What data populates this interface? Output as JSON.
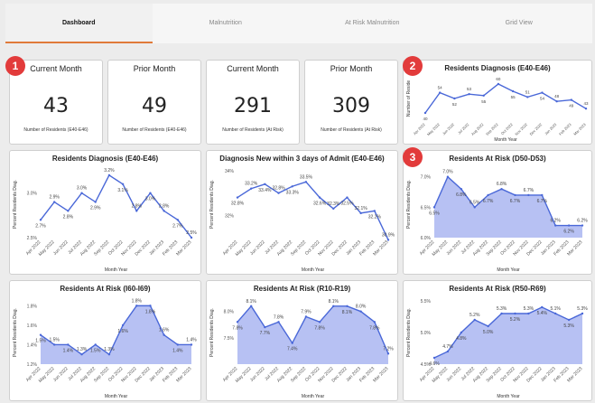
{
  "tabs": [
    {
      "label": "Dashboard",
      "active": true
    },
    {
      "label": "Malnutrition",
      "active": false
    },
    {
      "label": "At Risk Malnutrition",
      "active": false
    },
    {
      "label": "Grid View",
      "active": false
    }
  ],
  "badges": [
    "1",
    "2",
    "3"
  ],
  "kpis": [
    {
      "title": "Current Month",
      "value": "43",
      "sub": "Number of Residents (E40-E46)"
    },
    {
      "title": "Prior Month",
      "value": "49",
      "sub": "Number of Residents (E40-E46)"
    },
    {
      "title": "Current Month",
      "value": "291",
      "sub": "Number of Residents (At Risk)"
    },
    {
      "title": "Prior Month",
      "value": "309",
      "sub": "Number of Residents (At Risk)"
    }
  ],
  "months": [
    "Apr 2022",
    "May 2022",
    "Jun 2022",
    "Jul 2022",
    "Aug 2022",
    "Sep 2022",
    "Oct 2022",
    "Nov 2022",
    "Dec 2022",
    "Jan 2023",
    "Feb 2023",
    "Mar 2023"
  ],
  "colors": {
    "line": "#4a68d8",
    "area": "#aab6f1",
    "accent": "#e07a3a",
    "badge": "#e23b3b"
  },
  "chart_data": [
    {
      "type": "line",
      "title": "Residents Diagnosis (E40-E46)",
      "xlabel": "Month Year",
      "ylabel": "Number of Reside",
      "values": [
        40,
        54,
        50,
        53,
        52,
        60,
        55,
        51,
        54,
        48,
        49,
        43
      ],
      "labels": [
        "40",
        "54",
        "52",
        "53",
        "55",
        "60",
        "55",
        "51",
        "54",
        "48",
        "49",
        "43"
      ],
      "ylim": [
        35,
        65
      ],
      "area": false
    },
    {
      "type": "line",
      "title": "Residents Diagnosis (E40-E46)",
      "xlabel": "Month Year",
      "ylabel": "Percent Residents Diag.",
      "values": [
        2.7,
        2.9,
        2.8,
        3.0,
        2.9,
        3.2,
        3.1,
        2.8,
        3.0,
        2.8,
        2.7,
        2.5
      ],
      "labels": [
        "2.7%",
        "2.9%",
        "2.8%",
        "3.0%",
        "2.9%",
        "3.2%",
        "3.1%",
        "2.8%",
        "3.0%",
        "2.8%",
        "2.7%",
        "2.5%"
      ],
      "ylim": [
        2.5,
        3.25
      ],
      "yticks": [
        "2.5%",
        "3.0%"
      ],
      "area": false
    },
    {
      "type": "line",
      "title": "Diagnosis New within 3 days of Admit (E40-E46)",
      "xlabel": "Month Year",
      "ylabel": "Percent Residents Diag.",
      "values": [
        32.8,
        33.2,
        33.4,
        33.0,
        33.3,
        33.5,
        32.8,
        32.3,
        32.8,
        32.1,
        32.2,
        30.9
      ],
      "labels": [
        "32.8%",
        "33.2%",
        "33.4%",
        "32.8%",
        "33.3%",
        "33.5%",
        "32.6%",
        "32.3%",
        "32.5%",
        "32.1%",
        "32.2%",
        "30.9%"
      ],
      "ylim": [
        31,
        34
      ],
      "yticks": [
        "32%",
        "34%"
      ],
      "area": false
    },
    {
      "type": "area",
      "title": "Residents At Risk (D50-D53)",
      "xlabel": "Month Year",
      "ylabel": "Percent Residents Diag.",
      "values": [
        6.5,
        7.0,
        6.8,
        6.5,
        6.7,
        6.8,
        6.7,
        6.7,
        6.7,
        6.2,
        6.2,
        6.2
      ],
      "labels": [
        "6.5%",
        "7.0%",
        "6.8%",
        "6.5%",
        "6.7%",
        "6.8%",
        "6.7%",
        "6.7%",
        "6.7%",
        "6.2%",
        "6.2%",
        "6.2%"
      ],
      "ylim": [
        6.0,
        7.1
      ],
      "yticks": [
        "6.0%",
        "6.5%",
        "7.0%"
      ],
      "area": true
    },
    {
      "type": "area",
      "title": "Residents At Risk (I60-I69)",
      "xlabel": "Month Year",
      "ylabel": "Percent Residents Diag.",
      "values": [
        1.5,
        1.4,
        1.4,
        1.3,
        1.4,
        1.3,
        1.6,
        1.8,
        1.8,
        1.5,
        1.4,
        1.4
      ],
      "labels": [
        "1.5%",
        "1.5%",
        "1.4%",
        "1.3%",
        "1.5%",
        "1.3%",
        "1.6%",
        "1.8%",
        "1.8%",
        "1.6%",
        "1.4%",
        "1.4%"
      ],
      "ylim": [
        1.2,
        1.85
      ],
      "yticks": [
        "1.2%",
        "1.4%",
        "1.6%",
        "1.8%"
      ],
      "area": true
    },
    {
      "type": "area",
      "title": "Residents At Risk (R10-R19)",
      "xlabel": "Month Year",
      "ylabel": "Percent Residents Diag.",
      "values": [
        7.8,
        8.1,
        7.7,
        7.8,
        7.4,
        7.9,
        7.8,
        8.1,
        8.1,
        8.0,
        7.8,
        7.2
      ],
      "labels": [
        "7.8%",
        "8.1%",
        "7.7%",
        "7.8%",
        "7.4%",
        "7.9%",
        "7.8%",
        "8.1%",
        "8.1%",
        "8.0%",
        "7.8%",
        "7.2%"
      ],
      "ylim": [
        7.0,
        8.2
      ],
      "yticks": [
        "7.5%",
        "8.0%"
      ],
      "area": true
    },
    {
      "type": "area",
      "title": "Residents At Risk (R50-R69)",
      "xlabel": "Month Year",
      "ylabel": "Percent Residents Diag.",
      "values": [
        4.6,
        4.7,
        5.0,
        5.2,
        5.1,
        5.3,
        5.3,
        5.3,
        5.4,
        5.3,
        5.2,
        5.3
      ],
      "labels": [
        "4.6%",
        "4.7%",
        "4.8%",
        "5.2%",
        "5.0%",
        "5.3%",
        "5.2%",
        "5.3%",
        "5.4%",
        "5.1%",
        "5.3%",
        "5.3%"
      ],
      "ylim": [
        4.5,
        5.5
      ],
      "yticks": [
        "4.5%",
        "5.0%",
        "5.5%"
      ],
      "area": true
    }
  ]
}
